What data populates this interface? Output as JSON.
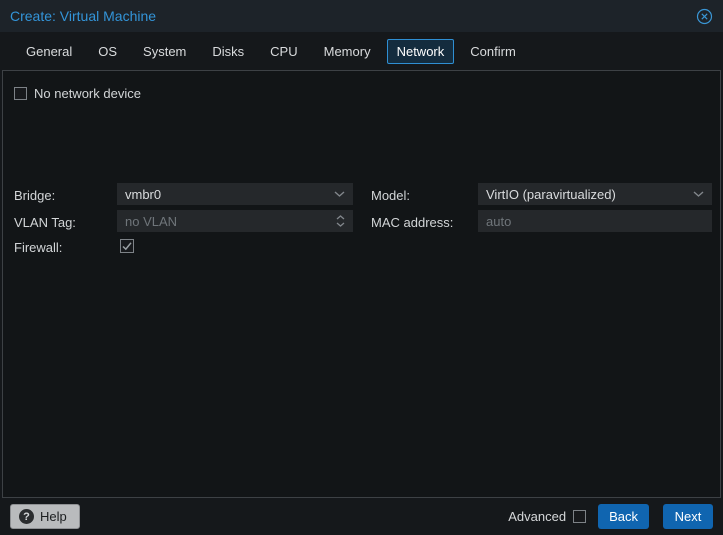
{
  "window": {
    "title": "Create: Virtual Machine",
    "close_icon": "circle-x-icon"
  },
  "tabs": [
    {
      "label": "General",
      "active": false
    },
    {
      "label": "OS",
      "active": false
    },
    {
      "label": "System",
      "active": false
    },
    {
      "label": "Disks",
      "active": false
    },
    {
      "label": "CPU",
      "active": false
    },
    {
      "label": "Memory",
      "active": false
    },
    {
      "label": "Network",
      "active": true
    },
    {
      "label": "Confirm",
      "active": false
    }
  ],
  "form": {
    "no_network_device": {
      "label": "No network device",
      "checked": false
    },
    "bridge": {
      "label": "Bridge:",
      "value": "vmbr0",
      "control": "combobox",
      "icon": "chevron-down-icon"
    },
    "vlan_tag": {
      "label": "VLAN Tag:",
      "placeholder": "no VLAN",
      "control": "number-spinner",
      "icon": "spinner-up-down-icon"
    },
    "firewall": {
      "label": "Firewall:",
      "checked": true
    },
    "model": {
      "label": "Model:",
      "value": "VirtIO (paravirtualized)",
      "control": "combobox",
      "icon": "chevron-down-icon"
    },
    "mac_address": {
      "label": "MAC address:",
      "placeholder": "auto",
      "control": "textfield"
    }
  },
  "footer": {
    "help_label": "Help",
    "help_icon": "question-mark-icon",
    "advanced_label": "Advanced",
    "advanced_checked": false,
    "back_label": "Back",
    "next_label": "Next"
  },
  "colors": {
    "accent_blue": "#3394d8",
    "active_tab_border": "#2f8fd3",
    "active_tab_bg": "#142c3e",
    "button_blue": "#1065b0",
    "titlebar_bg": "#1d2329",
    "window_bg": "#15181b",
    "panel_bg": "#121517",
    "field_bg": "#25282b",
    "text_light": "#d2d5d7",
    "text_placeholder": "#6f757a"
  }
}
